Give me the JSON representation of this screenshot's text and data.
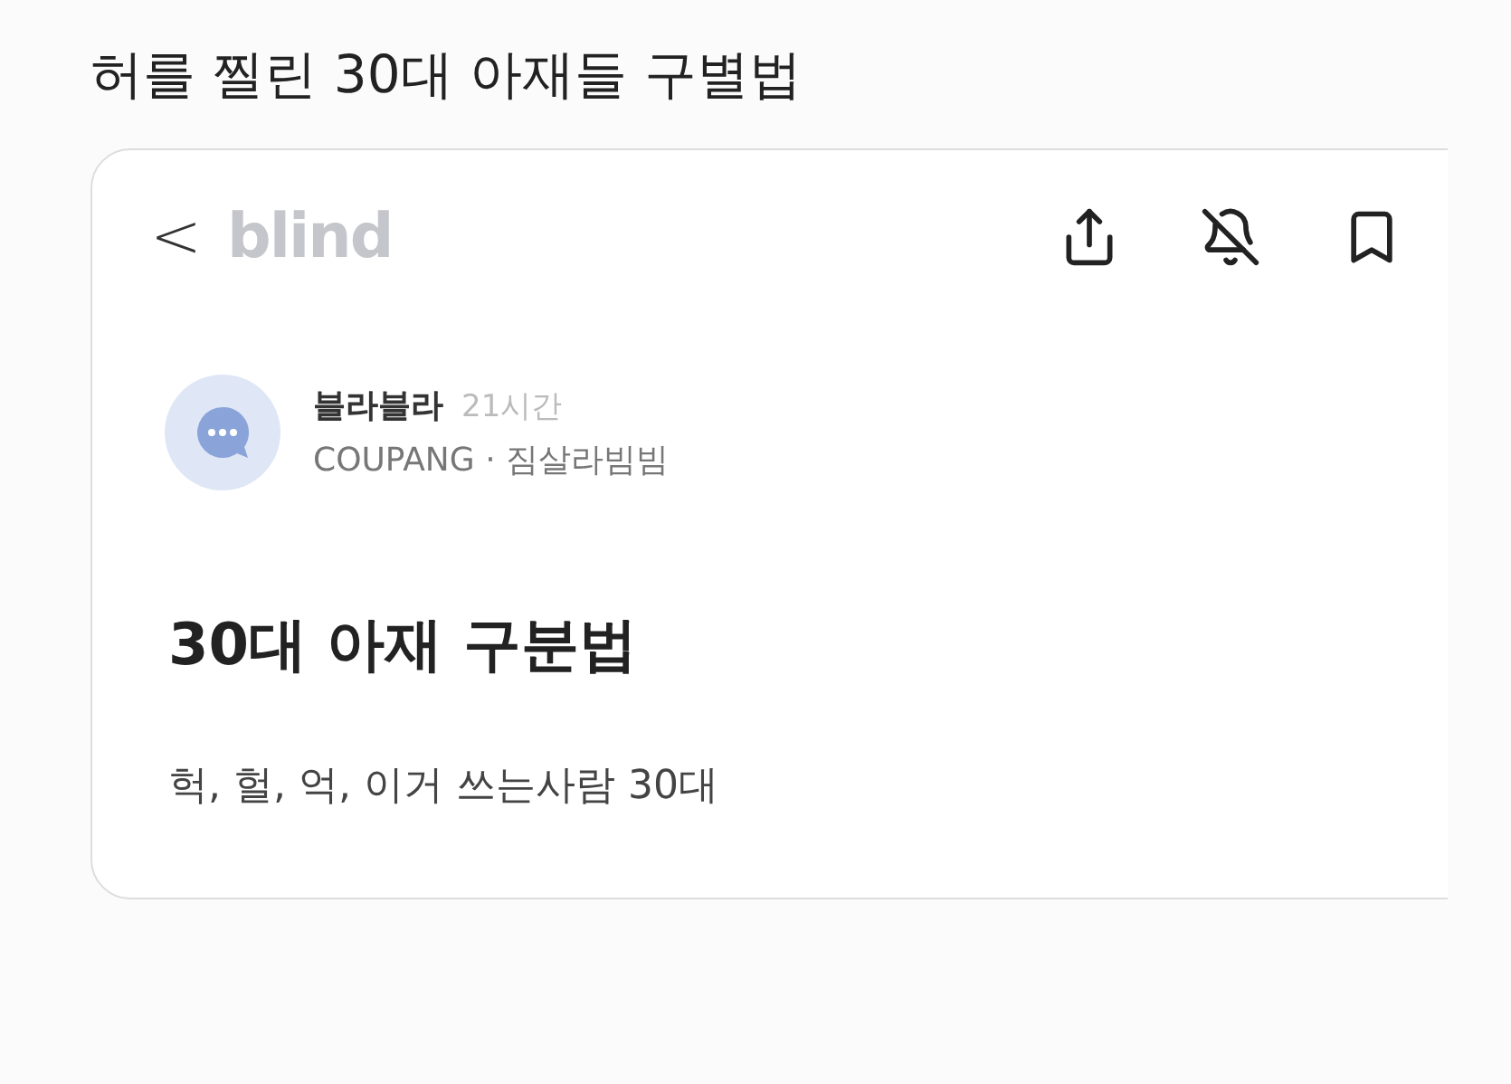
{
  "headline": "허를 찔린 30대 아재들 구별법",
  "app": {
    "back": "<",
    "logo": "blind"
  },
  "post": {
    "author": "블라블라",
    "time": "21시간",
    "company": "COUPANG",
    "separator": "·",
    "nickname": "짐살라빔빔",
    "title": "30대 아재 구분법",
    "body": "헉, 헐, 억, 이거 쓰는사람 30대"
  }
}
